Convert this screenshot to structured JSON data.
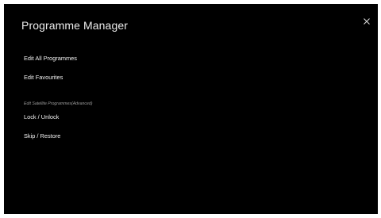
{
  "header": {
    "title": "Programme Manager",
    "close_icon": "close-icon"
  },
  "menu": {
    "edit_all": "Edit All Programmes",
    "edit_favourites": "Edit Favourites",
    "satellite_section_label": "Edit Satellite Programmes(Advanced)",
    "lock_unlock": "Lock / Unlock",
    "skip_restore": "Skip / Restore"
  },
  "colors": {
    "background": "#000000",
    "text": "#f2f2f2",
    "section_label": "#9a9a9a"
  }
}
